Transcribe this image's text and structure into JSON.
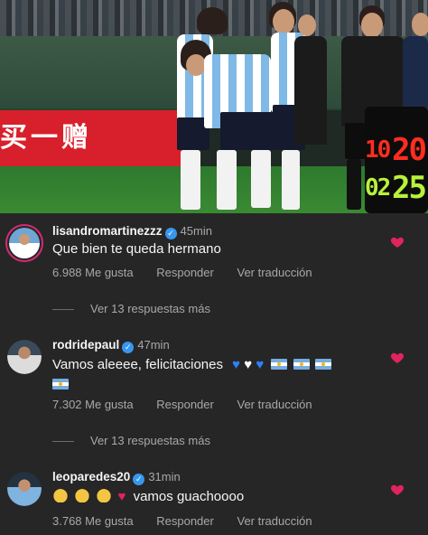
{
  "photo": {
    "banner_text": "买一赠",
    "board_top": "20",
    "board_bottom": "25",
    "board_top_left": "10",
    "board_bottom_left": "02"
  },
  "comments": [
    {
      "username": "lisandromartinezzz",
      "time": "45min",
      "text": "Que bien te queda hermano",
      "likes": "6.988 Me gusta",
      "reply": "Responder",
      "translate": "Ver traducción",
      "more_replies": "Ver 13 respuestas más"
    },
    {
      "username": "rodridepaul",
      "time": "47min",
      "text": "Vamos aleeee, felicitaciones",
      "likes": "7.302 Me gusta",
      "reply": "Responder",
      "translate": "Ver traducción",
      "more_replies": "Ver 13 respuestas más"
    },
    {
      "username": "leoparedes20",
      "time": "31min",
      "text": "vamos guachoooo",
      "likes": "3.768 Me gusta",
      "reply": "Responder",
      "translate": "Ver traducción"
    }
  ],
  "icons": {
    "verified": "verified-badge-icon",
    "like": "heart-icon"
  },
  "colors": {
    "background": "#262626",
    "like_red": "#e0245e",
    "verified_blue": "#3797f0",
    "muted_text": "#a8a8a8"
  }
}
